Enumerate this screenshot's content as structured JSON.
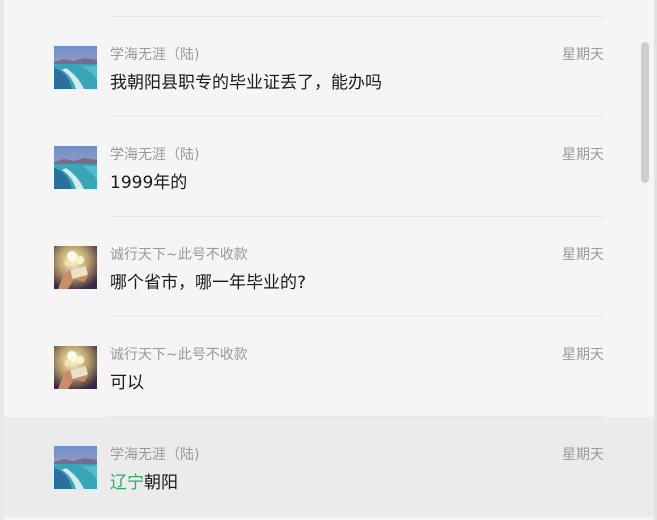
{
  "messages": [
    {
      "sender": "学海无涯（陆)",
      "time": "星期天",
      "text_pre": "",
      "text_highlight": "",
      "text_main": "我朝阳县职专的毕业证丢了，能办吗",
      "avatar": "seaside-avatar-icon",
      "selected": false
    },
    {
      "sender": "学海无涯（陆)",
      "time": "星期天",
      "text_pre": "",
      "text_highlight": "",
      "text_main": "1999年的",
      "avatar": "seaside-avatar-icon",
      "selected": false
    },
    {
      "sender": "诚行天下~此号不收款",
      "time": "星期天",
      "text_pre": "",
      "text_highlight": "",
      "text_main": "哪个省市，哪一年毕业的?",
      "avatar": "coin-hand-avatar-icon",
      "selected": false
    },
    {
      "sender": "诚行天下~此号不收款",
      "time": "星期天",
      "text_pre": "",
      "text_highlight": "",
      "text_main": "可以",
      "avatar": "coin-hand-avatar-icon",
      "selected": false
    },
    {
      "sender": "学海无涯（陆)",
      "time": "星期天",
      "text_pre": "",
      "text_highlight": "辽宁",
      "text_main": "朝阳",
      "avatar": "seaside-avatar-icon",
      "selected": true
    }
  ],
  "colors": {
    "background": "#f5f5f5",
    "selected_row": "#ebebeb",
    "meta_text": "#999999",
    "message_text": "#1a1a1a",
    "keyword_highlight": "#2aae67"
  }
}
